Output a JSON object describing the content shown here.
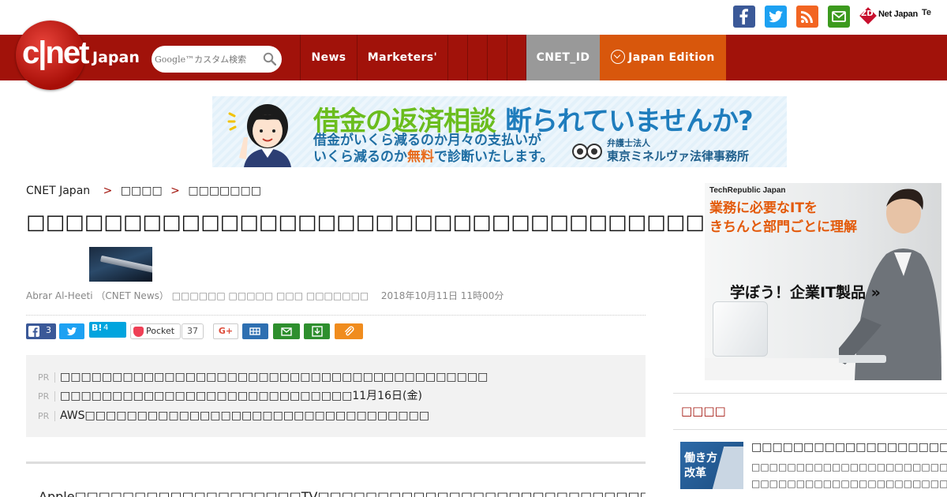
{
  "header": {
    "social": [
      {
        "name": "facebook",
        "color": "#3b5998"
      },
      {
        "name": "twitter",
        "color": "#1da1f2"
      },
      {
        "name": "rss",
        "color": "#f26522"
      },
      {
        "name": "mail",
        "color": "#3c9a1e"
      }
    ],
    "zdnet_mark": "ZD",
    "zdnet_label": "Net Japan",
    "techrepublic_label": "Te"
  },
  "nav": {
    "logo": "c|net",
    "edition": "Japan",
    "search_placeholder": "Google™カスタム検索",
    "items": [
      "News",
      "Marketers'"
    ],
    "cnet_id": "CNET_ID",
    "japan_edition": "Japan Edition"
  },
  "banner_ad": {
    "headline_a": "借金の返済相談",
    "headline_b": "断られていませんか?",
    "sub_line1": "借金がいくら減るのか月々の支払いが",
    "sub_line2a": "いくら減るのか",
    "sub_line2b": "無料",
    "sub_line2c": "で診断いたします。",
    "firm_prefix": "弁護士法人",
    "firm_name": "東京ミネルヴァ法律事務所"
  },
  "breadcrumb": {
    "home": "CNET Japan",
    "sep": ">",
    "level1": "□□□□",
    "level2": "□□□□□□□"
  },
  "article": {
    "title": "□□□□□□□□□□□□□□□□□□□□□□□□□□□□□□□□□□□□□□",
    "byline": "Abrar Al-Heeti （CNET News） □□□□□□ □□□□□ □□□ □□□□□□□",
    "date": "2018年10月11日 11時00分",
    "share": {
      "facebook_count": "3",
      "hatena_label": "B!",
      "hatena_count": "4",
      "pocket_label": "Pocket",
      "pocket_count": "37",
      "gplus_label": "G+"
    },
    "pr_label": "PR",
    "pr_items": [
      "□□□□□□□□□□□□□□□□□□□□□□□□□□□□□□□□□□□□□□□□□",
      "□□□□□□□□□□□□□□□□□□□□□□□□□□□□11月16日(金)",
      "AWS□□□□□□□□□□□□□□□□□□□□□□□□□□□□□□□□□"
    ],
    "body_start": "　Apple□□□□□□□□□□□□□□□□□□□TV□□□□□□□□□□□□□□□□□□□□□□□□□□□□□□□□□□□□CNBC□□□□"
  },
  "sidebar": {
    "ad": {
      "brand": "TechRepublic Japan",
      "headline1": "業務に必要なITを",
      "headline2": "きちんと部門ごとに理解",
      "cta": "学ぼう！企業IT製品 »"
    },
    "popular_heading": "□□□□",
    "popular": [
      {
        "thumb_line1": "働き方",
        "thumb_line2": "改革",
        "title": "□□□□□□□□□□□□□□□□□□□□□",
        "sub1": "□□□□□□□□□□□□□□□□□□□□□□□□□",
        "sub2": "□□□□□□□□□□□□□□□□□□□□□□□"
      }
    ]
  }
}
